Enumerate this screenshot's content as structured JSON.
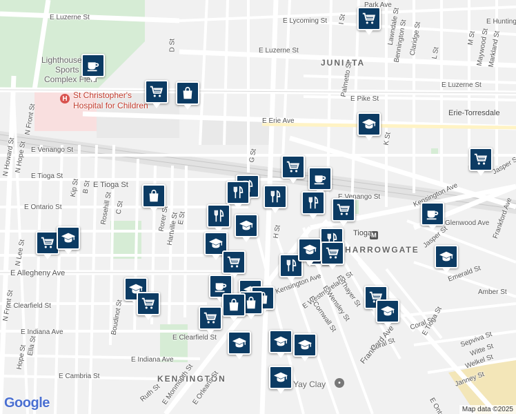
{
  "street_labels": [
    "E Luzerne St",
    "E Luzerne St",
    "E Lycoming St",
    "JUNIATA",
    "E Luzerne St",
    "Lighthouse",
    "Sports",
    "Complex Field",
    "St Christopher's",
    "Hospital for Children",
    "D St",
    "E Erie Ave",
    "E Pike St",
    "Erie-Torresdale",
    "E Venango St",
    "E Tioga St",
    "E Tioga St",
    "E Ontario St",
    "E Venango St",
    "Kensington Ave",
    "Glenwood Ave",
    "Tioga",
    "HARROWGATE",
    "E Allegheny Ave",
    "E Clearfield St",
    "E Clearfield St",
    "E Indiana Ave",
    "E Indiana Ave",
    "E Cambria St",
    "KENSINGTON",
    "N Front St",
    "N Howard St",
    "N Hope St",
    "N Lee St",
    "Kip St",
    "B St",
    "Rosehill St",
    "C St",
    "Boudinot St",
    "Rorer St",
    "Hartville St",
    "E St",
    "H St",
    "I St",
    "G St",
    "K St",
    "L St",
    "M St",
    "Palmetto St",
    "Lawndale St",
    "Bennington St",
    "Claridge St",
    "Maywood St",
    "Markland St",
    "Jasper St",
    "Jasper St",
    "Kensington Ave",
    "E Westmoreland St",
    "E Cornwall St",
    "E Wensley St",
    "E Thayer St",
    "Frankford Ave",
    "Coral St",
    "Coral St",
    "E Tioga St",
    "Sepviva St",
    "Witte St",
    "Janney St",
    "Welkel St",
    "Amber St",
    "Emerald St",
    "Ruth St",
    "E Monmouth St",
    "E Orleans St",
    "E Ontario St",
    "Yay Clay",
    "Ella St",
    "Hope St",
    "E Huntingdon St",
    "Park Ave",
    "Frankford Ave",
    "N Front St"
  ],
  "markers": [
    {
      "icon": "coffee-icon"
    },
    {
      "icon": "cart-icon"
    },
    {
      "icon": "bag-icon"
    },
    {
      "icon": "cart-icon"
    },
    {
      "icon": "school-icon"
    },
    {
      "icon": "cart-icon"
    },
    {
      "icon": "cart-icon"
    },
    {
      "icon": "coffee-icon"
    },
    {
      "icon": "restaurant-icon"
    },
    {
      "icon": "restaurant-icon"
    },
    {
      "icon": "restaurant-icon"
    },
    {
      "icon": "restaurant-icon"
    },
    {
      "icon": "cart-icon"
    },
    {
      "icon": "bag-icon"
    },
    {
      "icon": "restaurant-icon"
    },
    {
      "icon": "school-icon"
    },
    {
      "icon": "school-icon"
    },
    {
      "icon": "coffee-icon"
    },
    {
      "icon": "restaurant-icon"
    },
    {
      "icon": "cart-icon"
    },
    {
      "icon": "cart-icon"
    },
    {
      "icon": "restaurant-icon"
    },
    {
      "icon": "school-icon"
    },
    {
      "icon": "cart-icon"
    },
    {
      "icon": "school-icon"
    },
    {
      "icon": "school-icon"
    },
    {
      "icon": "cart-icon"
    },
    {
      "icon": "cart-icon"
    },
    {
      "icon": "school-icon"
    },
    {
      "icon": "coffee-icon"
    },
    {
      "icon": "school-icon"
    },
    {
      "icon": "bag-icon"
    },
    {
      "icon": "bag-icon"
    },
    {
      "icon": "bag-icon"
    },
    {
      "icon": "cart-icon"
    },
    {
      "icon": "school-icon"
    },
    {
      "icon": "school-icon"
    },
    {
      "icon": "school-icon"
    },
    {
      "icon": "cart-icon"
    },
    {
      "icon": "school-icon"
    },
    {
      "icon": "school-icon"
    }
  ],
  "branding": {
    "logo": "Google",
    "attribution": "Map data ©2025"
  },
  "colors": {
    "marker": "#0c3b63",
    "hospital": "#d9534f",
    "park": "#c8e6c9",
    "hospital_area": "#f8dede"
  }
}
